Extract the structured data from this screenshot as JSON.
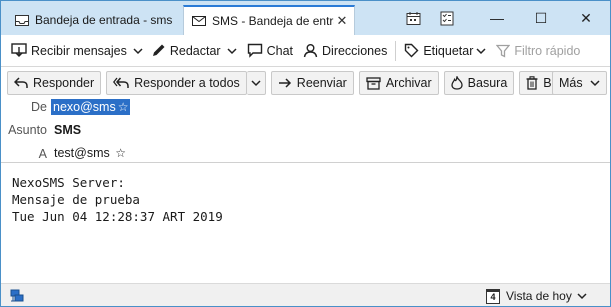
{
  "tabs": [
    {
      "title": "Bandeja de entrada - sms"
    },
    {
      "title": "SMS - Bandeja de entra",
      "close": "✕"
    }
  ],
  "window_controls": {
    "minimize": "—",
    "maximize": "☐",
    "close": "✕"
  },
  "toolbar": {
    "get_messages": "Recibir mensajes",
    "write": "Redactar",
    "chat": "Chat",
    "address_book": "Direcciones",
    "tag": "Etiquetar",
    "quick_filter": "Filtro rápido"
  },
  "message_actions": {
    "reply": "Responder",
    "reply_all": "Responder a todos",
    "forward": "Reenviar",
    "archive": "Archivar",
    "junk": "Basura",
    "delete": "Borrar",
    "more": "Más"
  },
  "header": {
    "from_label": "De",
    "from_value": "nexo@sms",
    "subject_label": "Asunto",
    "subject_value": "SMS",
    "to_label": "A",
    "to_value": "test@sms"
  },
  "body": {
    "text": "NexoSMS Server:\nMensaje de prueba\nTue Jun 04 12:28:37 ART 2019"
  },
  "statusbar": {
    "today_pane": "Vista de hoy",
    "today_day": "4"
  },
  "colors": {
    "tabbar": "#cde3f4",
    "accent": "#2b6fc7",
    "border": "#4a90c8"
  }
}
